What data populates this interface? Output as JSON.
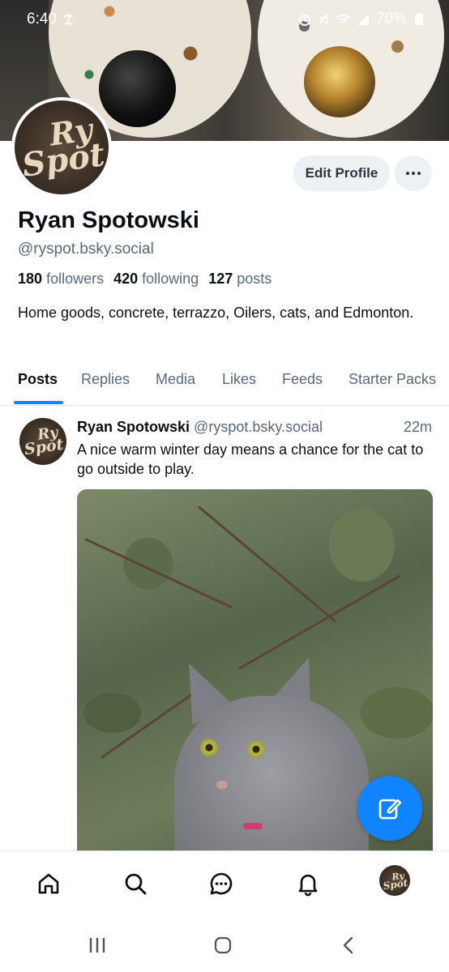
{
  "status_bar": {
    "time": "6:40",
    "left_icon": "nyt-news-icon",
    "battery": "70%"
  },
  "profile": {
    "display_name": "Ryan Spotowski",
    "handle": "@ryspot.bsky.social",
    "followers_count": "180",
    "followers_label": "followers",
    "following_count": "420",
    "following_label": "following",
    "posts_count": "127",
    "posts_label": "posts",
    "bio": "Home goods, concrete, terrazzo, Oilers, cats, and Edmonton.",
    "edit_button": "Edit Profile",
    "avatar_logo_top": "Ry",
    "avatar_logo_bottom": "Spot"
  },
  "tabs": [
    "Posts",
    "Replies",
    "Media",
    "Likes",
    "Feeds",
    "Starter Packs"
  ],
  "active_tab": "Posts",
  "post": {
    "author": "Ryan Spotowski",
    "handle": "@ryspot.bsky.social",
    "time": "22m",
    "text": "A nice warm winter day means a chance for the cat to go outside to play.",
    "image_subject": "grey long-haired cat among evergreen branches"
  },
  "bottom_nav": [
    "home-icon",
    "search-icon",
    "chat-icon",
    "notifications-icon",
    "profile-avatar"
  ],
  "colors": {
    "accent": "#1083fe",
    "secondary_text": "#59687a",
    "button_bg": "#eef1f4"
  }
}
